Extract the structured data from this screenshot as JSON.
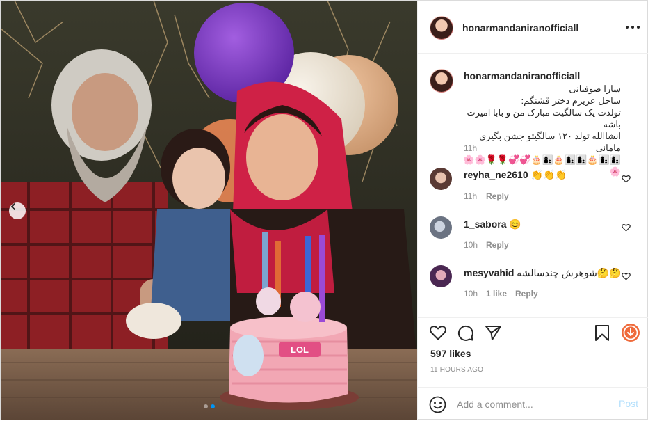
{
  "post": {
    "author": "honarmandaniranofficiall",
    "more_icon": "more-horizontal-icon",
    "caption": "سارا صوفیانی\nساحل عزیزم دختر قشنگم:\nتولدت یک سالگیت مبارک من و بابا امیرت باشه\nانشاالله تولد ۱۲۰ سالگیتو جشن بگیری مامانی\n👩‍👦👩‍👦🎂👩‍👦👩‍👦🎂👩‍👦🎂💞💞🌹🌹🌸🌸🌸",
    "caption_time": "11h"
  },
  "comments": [
    {
      "user": "reyha_ne2610",
      "text": "👏👏👏",
      "time": "11h",
      "likes": "",
      "reply_label": "Reply"
    },
    {
      "user": "1_sabora",
      "text": "😊",
      "time": "10h",
      "likes": "",
      "reply_label": "Reply"
    },
    {
      "user": "mesyvahid",
      "text": "شوهرش چندسالشه🤔🤔",
      "time": "10h",
      "likes": "1 like",
      "reply_label": "Reply"
    }
  ],
  "actions": {
    "like_icon": "heart-icon",
    "comment_icon": "comment-icon",
    "share_icon": "send-icon",
    "save_icon": "bookmark-icon",
    "download_icon": "download-icon"
  },
  "stats": {
    "likes": "597 likes",
    "time_ago": "11 HOURS AGO"
  },
  "composer": {
    "placeholder": "Add a comment...",
    "post_label": "Post",
    "emoji_icon": "smiley-icon"
  },
  "carousel": {
    "prev_icon": "chevron-left-icon",
    "slide_count": 2,
    "active_index": 1
  },
  "colors": {
    "link_blue": "#0095f6",
    "post_disabled": "#b2dffc",
    "muted": "#8e8e8e",
    "text": "#262626"
  }
}
